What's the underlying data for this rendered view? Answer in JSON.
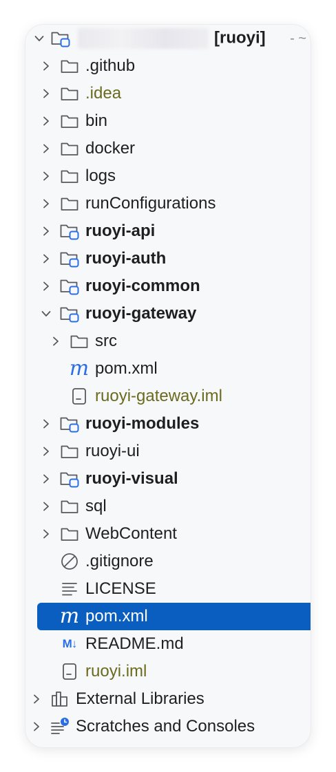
{
  "header": {
    "project_label": "[ruoyi]",
    "tail": "- ~"
  },
  "tree": {
    "github": ".github",
    "idea": ".idea",
    "bin": "bin",
    "docker": "docker",
    "logs": "logs",
    "runConfigurations": "runConfigurations",
    "ruoyi_api": "ruoyi-api",
    "ruoyi_auth": "ruoyi-auth",
    "ruoyi_common": "ruoyi-common",
    "ruoyi_gateway": "ruoyi-gateway",
    "gateway_src": "src",
    "gateway_pom": "pom.xml",
    "gateway_iml": "ruoyi-gateway.iml",
    "ruoyi_modules": "ruoyi-modules",
    "ruoyi_ui": "ruoyi-ui",
    "ruoyi_visual": "ruoyi-visual",
    "sql": "sql",
    "webcontent": "WebContent",
    "gitignore": ".gitignore",
    "license": "LICENSE",
    "pom": "pom.xml",
    "readme": "README.md",
    "ruoyi_iml": "ruoyi.iml",
    "external_libraries": "External Libraries",
    "scratches": "Scratches and Consoles"
  },
  "icons": {
    "m_glyph": "m",
    "md_glyph": "M↓"
  },
  "colors": {
    "selection": "#0a5ec0",
    "excluded_text": "#6b6a1f",
    "module_badge": "#2a6ee6"
  }
}
